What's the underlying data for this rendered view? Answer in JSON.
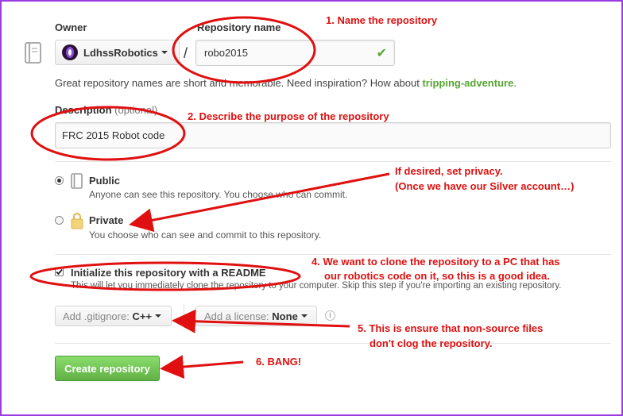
{
  "owner": {
    "label": "Owner",
    "name": "LdhssRobotics"
  },
  "slash": "/",
  "repo": {
    "label": "Repository name",
    "value": "robo2015",
    "valid_mark": "✔"
  },
  "hint": {
    "prefix": "Great repository names are short and memorable. Need inspiration? How about ",
    "suggestion": "tripping-adventure",
    "suffix": "."
  },
  "description": {
    "label": "Description",
    "optional": "(optional)",
    "value": "FRC 2015 Robot code"
  },
  "visibility": {
    "public": {
      "title": "Public",
      "desc": "Anyone can see this repository. You choose who can commit.",
      "selected": true
    },
    "private": {
      "title": "Private",
      "desc": "You choose who can see and commit to this repository.",
      "selected": false
    }
  },
  "readme": {
    "label": "Initialize this repository with a README",
    "desc": "This will let you immediately clone the repository to your computer. Skip this step if you're importing an existing repository.",
    "checked": true
  },
  "gitignore": {
    "label": "Add .gitignore:",
    "value": "C++"
  },
  "license": {
    "label": "Add a license:",
    "value": "None"
  },
  "info_icon": "i",
  "create_button": "Create repository",
  "annotations": {
    "a1": "1. Name the repository",
    "a2": "2. Describe the purpose of the repository",
    "a3_line1": "If desired, set privacy.",
    "a3_line2": "(Once we have our Silver account…)",
    "a4_line1": "4. We want to clone the repository to a PC that has",
    "a4_line2": "our robotics code on it, so this is a good idea.",
    "a5_line1": "5. This is ensure that non-source files",
    "a5_line2": "don't clog the repository.",
    "a6": "6. BANG!"
  },
  "colors": {
    "frame": "#9b3de0",
    "annotation": "#e01010",
    "success": "#55a532",
    "create_button": "#5cb85c"
  }
}
